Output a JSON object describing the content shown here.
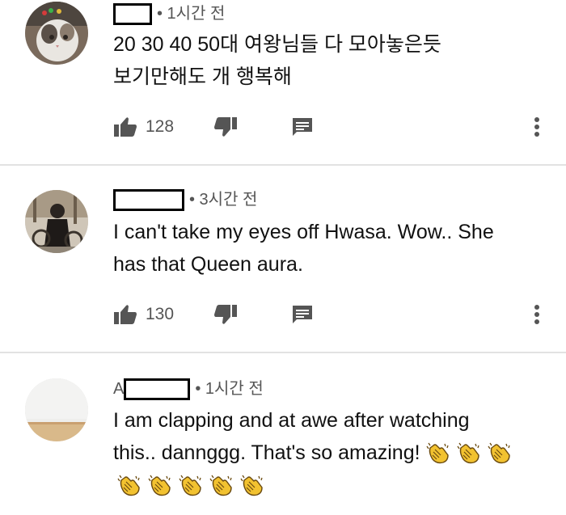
{
  "comments": [
    {
      "author_prefix": "",
      "time": "• 1시간 전",
      "lines": [
        "20 30 40 50대 여왕님들 다 모아놓은듯",
        "보기만해도 개 행복해"
      ],
      "extra_line": "",
      "likes": "128",
      "avatar": "cat-avatar",
      "icons": {
        "like": "thumbs-up-icon",
        "dislike": "thumbs-down-icon",
        "reply": "reply-icon",
        "more": "more-vert-icon"
      }
    },
    {
      "author_prefix": "",
      "time": "• 3시간 전",
      "lines": [
        "I can't take my eyes off Hwasa. Wow.. She",
        "has that Queen aura."
      ],
      "extra_line": "",
      "likes": "130",
      "avatar": "person-avatar",
      "icons": {
        "like": "thumbs-up-icon",
        "dislike": "thumbs-down-icon",
        "reply": "reply-icon",
        "more": "more-vert-icon"
      }
    },
    {
      "author_prefix": "A",
      "time": "• 1시간 전",
      "lines": [
        "I am clapping and at awe after watching",
        "this.. dannggg. That's so amazing!"
      ],
      "clap_emoji": "👏",
      "clap_count_line2": 3,
      "clap_count_line3": 5,
      "avatar": "room-avatar"
    }
  ],
  "colors": {
    "divider": "#e2e2e2",
    "icon": "#555555",
    "clap": "#f2c230"
  }
}
